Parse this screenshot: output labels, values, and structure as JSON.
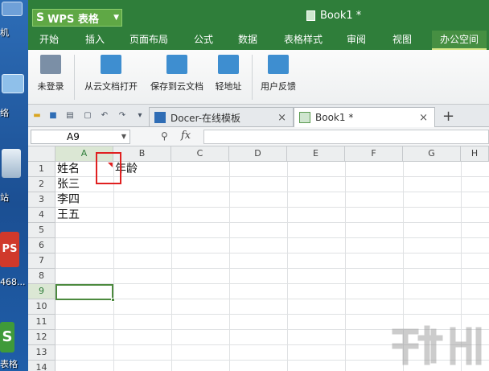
{
  "desktop": {
    "icons": [
      {
        "name": "computer",
        "label": "机"
      },
      {
        "name": "network",
        "label": "络"
      },
      {
        "name": "recycle-bin",
        "label": "站"
      },
      {
        "name": "wps-installer",
        "label": "468..."
      },
      {
        "name": "wps-spreadsheet",
        "label": "表格"
      }
    ]
  },
  "titlebar": {
    "app_logo": "S",
    "app_name": "WPS 表格",
    "doc_title": "Book1 *"
  },
  "ribbon_tabs": [
    "开始",
    "插入",
    "页面布局",
    "公式",
    "数据",
    "表格样式",
    "审阅",
    "视图",
    "办公空间"
  ],
  "ribbon_active_tab": "办公空间",
  "ribbon_buttons": [
    {
      "label": "未登录",
      "icon": "user-icon"
    },
    {
      "label": "从云文档打开",
      "icon": "cloud-open-icon"
    },
    {
      "label": "保存到云文档",
      "icon": "cloud-save-icon"
    },
    {
      "label": "轻地址",
      "icon": "link-icon"
    },
    {
      "label": "用户反馈",
      "icon": "feedback-icon"
    }
  ],
  "doc_tabs": [
    {
      "label": "Docer-在线模板",
      "active": false
    },
    {
      "label": "Book1 *",
      "active": true
    }
  ],
  "formula_bar": {
    "cell_ref": "A9",
    "fx_label": "fx",
    "content": ""
  },
  "columns": [
    "A",
    "B",
    "C",
    "D",
    "E",
    "F",
    "G",
    "H"
  ],
  "rows": [
    "1",
    "2",
    "3",
    "4",
    "5",
    "6",
    "7",
    "8",
    "9",
    "10",
    "11",
    "12",
    "13",
    "14"
  ],
  "selected_cell": "A9",
  "cells": {
    "A1": "姓名",
    "B1": "年龄",
    "A2": "张三",
    "A3": "李四",
    "A4": "王五"
  },
  "colors": {
    "title_green": "#2f7e3a",
    "accent_green": "#4c8a3e",
    "annotation_red": "#e02020"
  }
}
